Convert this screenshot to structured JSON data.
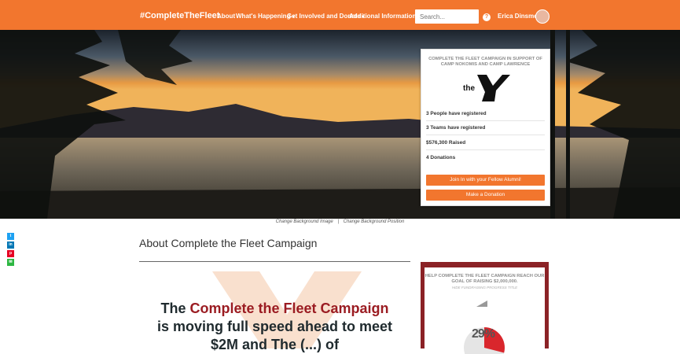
{
  "nav": {
    "brand": "#CompleteTheFleet",
    "items": [
      {
        "label": "About",
        "dropdown": false
      },
      {
        "label": "What's Happening",
        "dropdown": true
      },
      {
        "label": "Get Involved and Donate",
        "dropdown": true
      },
      {
        "label": "Additional Information",
        "dropdown": true
      }
    ],
    "search_placeholder": "Search...",
    "help_icon": "question-circle-icon",
    "user_name": "Erica Dinsmore",
    "accent": "#f2762e"
  },
  "card": {
    "title": "COMPLETE THE FLEET CAMPAIGN IN SUPPORT OF CAMP NOKOMIS AND CAMP LAWRENCE",
    "logo_text": "the",
    "stats": [
      "3 People have registered",
      "3 Teams have registered",
      "$576,300 Raised",
      "4 Donations"
    ],
    "join_button": "Join In with your Fellow Alumni!",
    "donate_button": "Make a Donation"
  },
  "background_links": {
    "change_image": "Change Background Image",
    "separator": "|",
    "change_position": "Change Background Position"
  },
  "social": [
    {
      "icon": "twitter-icon",
      "glyph": "t",
      "color": "#1da1f2"
    },
    {
      "icon": "linkedin-icon",
      "glyph": "in",
      "color": "#0077b5"
    },
    {
      "icon": "pinterest-icon",
      "glyph": "p",
      "color": "#e60023"
    },
    {
      "icon": "email-icon",
      "glyph": "✉",
      "color": "#2db742"
    }
  ],
  "about": {
    "title": "About Complete the Fleet Campaign",
    "headline_pre": "The ",
    "headline_highlight": "Complete the Fleet Campaign",
    "headline_line2": "is moving full speed ahead to meet",
    "headline_line3": "$2M and The (...) of",
    "highlight_color": "#9b1c22"
  },
  "goal": {
    "title": "HELP COMPLETE THE FLEET CAMPAIGN REACH OUR GOAL OF RAISING $2,000,000.",
    "subtitle": "HIDE FUNDRAISING PROGRESS TITLE",
    "percent_label": "29%",
    "progress": 0.29,
    "panel_color": "#8b2226"
  }
}
